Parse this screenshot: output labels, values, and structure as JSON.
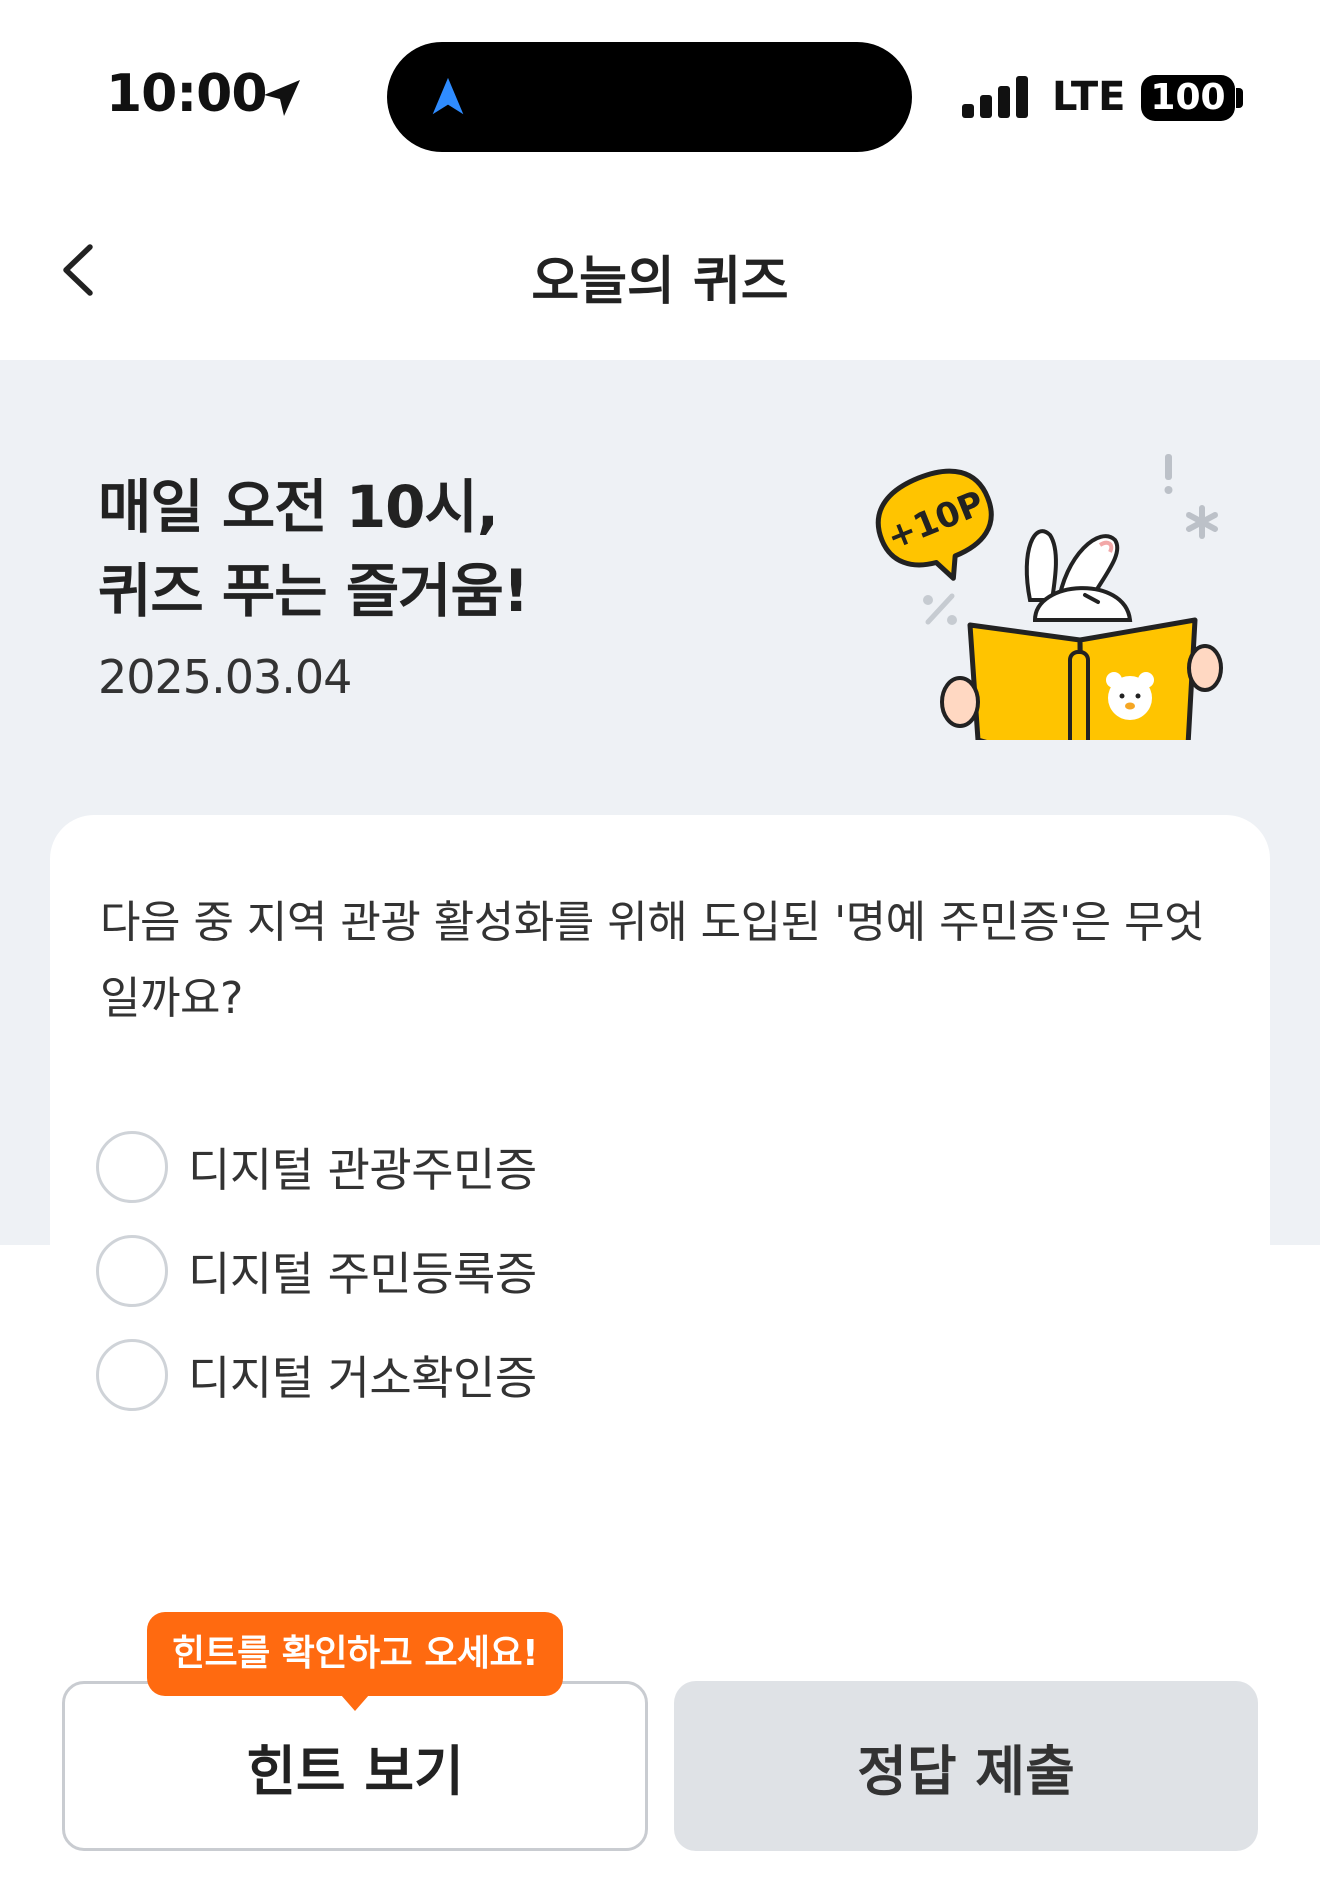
{
  "status_bar": {
    "time": "10:00",
    "network": "LTE",
    "battery": "100"
  },
  "header": {
    "title": "오늘의 퀴즈",
    "back_icon": "chevron-left-icon"
  },
  "hero": {
    "title_line1": "매일 오전 10시,",
    "title_line2": "퀴즈 푸는 즐거움!",
    "date": "2025.03.04",
    "badge": "+10P"
  },
  "quiz": {
    "question": "다음 중 지역 관광 활성화를 위해 도입된 '명예 주민증'은 무엇일까요?",
    "options": [
      {
        "label": "디지털 관광주민증",
        "selected": false
      },
      {
        "label": "디지털 주민등록증",
        "selected": false
      },
      {
        "label": "디지털 거소확인증",
        "selected": false
      }
    ]
  },
  "actions": {
    "hint_tooltip": "힌트를 확인하고 오세요!",
    "hint_label": "힌트 보기",
    "submit_label": "정답 제출"
  },
  "colors": {
    "accent_orange": "#ff6a10",
    "hero_bg": "#eef1f5",
    "book_yellow": "#ffc400",
    "disabled_button": "#dfe2e6"
  }
}
